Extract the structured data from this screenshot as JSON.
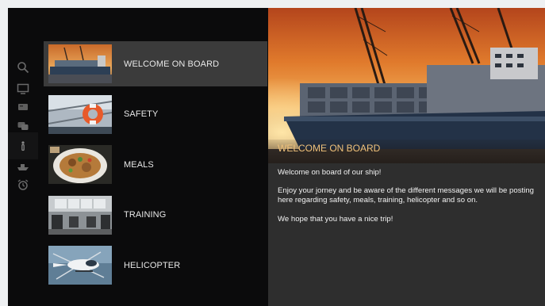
{
  "sidebar": {
    "icons": [
      "search-icon",
      "tv-icon",
      "card-icon",
      "chat-icon",
      "info-icon",
      "ship-icon",
      "alarm-clock-icon"
    ]
  },
  "menu": {
    "items": [
      {
        "label": "WELCOME ON BOARD",
        "icon": "cargo-ship-thumbnail"
      },
      {
        "label": "SAFETY",
        "icon": "lifebuoy-thumbnail"
      },
      {
        "label": "MEALS",
        "icon": "food-plate-thumbnail"
      },
      {
        "label": "TRAINING",
        "icon": "gym-thumbnail"
      },
      {
        "label": "HELICOPTER",
        "icon": "helicopter-thumbnail"
      }
    ],
    "selected_index": 0
  },
  "detail": {
    "title": "WELCOME ON BOARD",
    "paragraphs": [
      "Welcome on board of our ship!",
      "Enjoy your jorney and be aware of the different messages we will be posting here regarding safety, meals, training, helicopter and so on.",
      "We hope that you have a nice trip!"
    ]
  },
  "colors": {
    "background": "#0b0b0c",
    "selected_item": "#3b3b3b",
    "detail_panel": "#2e2e2e",
    "title_accent": "#f0c27b"
  }
}
